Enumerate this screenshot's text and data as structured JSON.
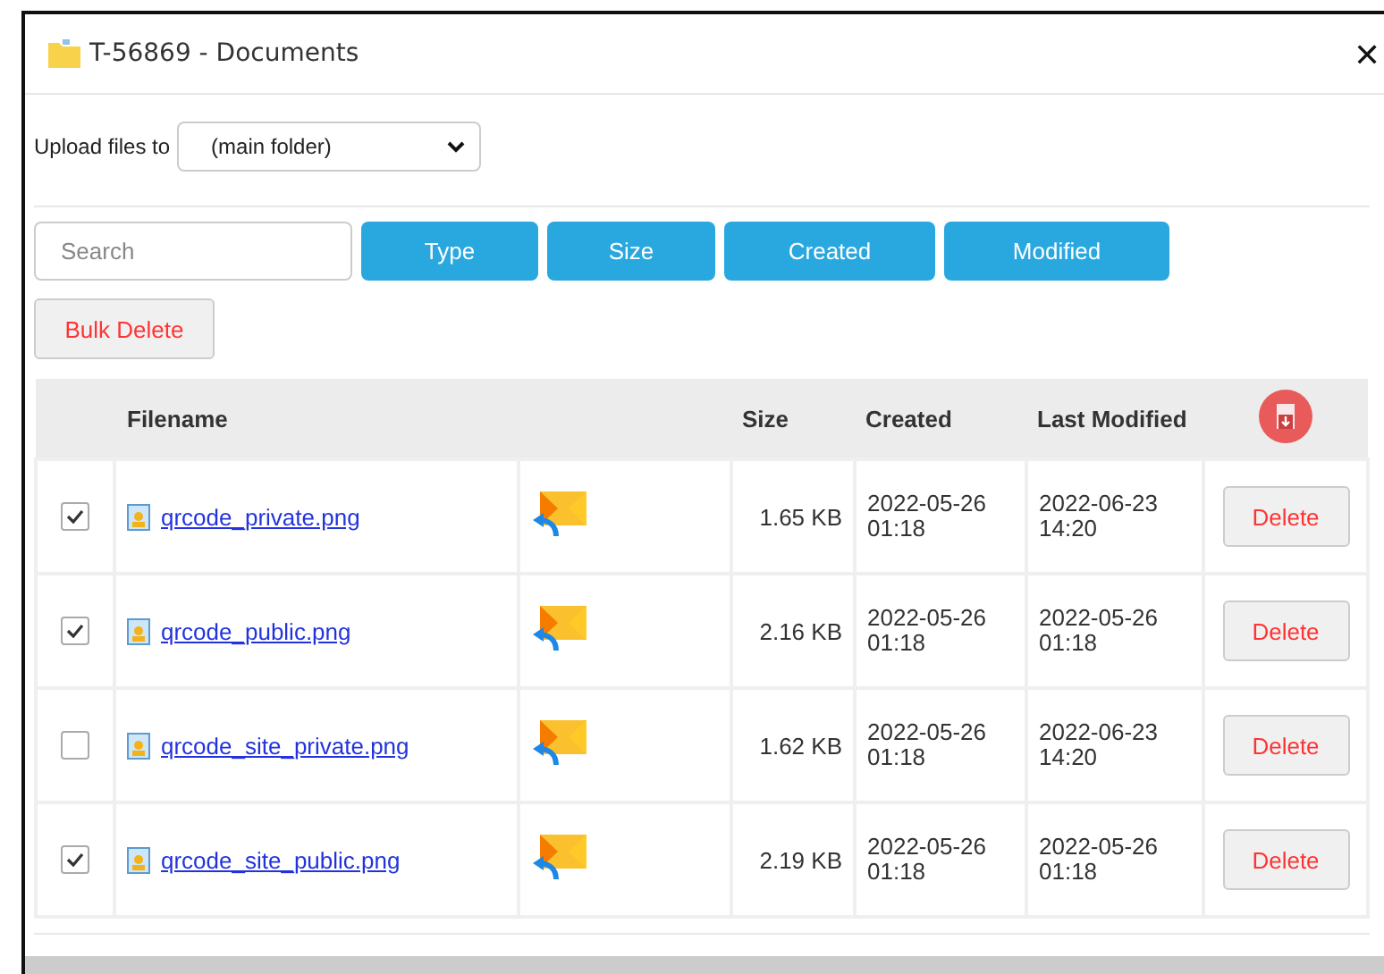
{
  "window": {
    "title": "T-56869 - Documents",
    "close": "✕"
  },
  "upload": {
    "label": "Upload files to",
    "value": "(main folder)"
  },
  "search": {
    "placeholder": "Search"
  },
  "filter_buttons": [
    "Type",
    "Size",
    "Created",
    "Modified"
  ],
  "bulk_delete": "Bulk Delete",
  "table": {
    "columns": [
      "Filename",
      "Size",
      "Created",
      "Last Modified"
    ],
    "rows": [
      {
        "checked": true,
        "filename": "qrcode_private.png",
        "size": "1.65 KB",
        "created": "2022-05-26 01:18",
        "modified": "2022-06-23 14:20",
        "action": "Delete"
      },
      {
        "checked": true,
        "filename": "qrcode_public.png",
        "size": "2.16 KB",
        "created": "2022-05-26 01:18",
        "modified": "2022-05-26 01:18",
        "action": "Delete"
      },
      {
        "checked": false,
        "filename": "qrcode_site_private.png",
        "size": "1.62 KB",
        "created": "2022-05-26 01:18",
        "modified": "2022-06-23 14:20",
        "action": "Delete"
      },
      {
        "checked": true,
        "filename": "qrcode_site_public.png",
        "size": "2.19 KB",
        "created": "2022-05-26 01:18",
        "modified": "2022-05-26 01:18",
        "action": "Delete"
      }
    ]
  }
}
